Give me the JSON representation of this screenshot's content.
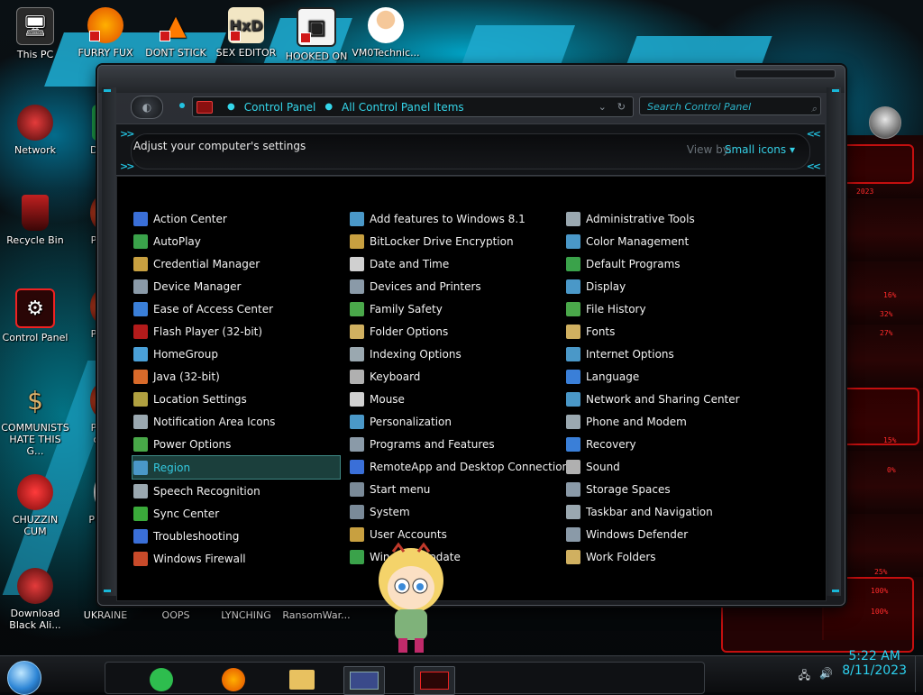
{
  "desktop": {
    "icons": [
      {
        "label": "This PC"
      },
      {
        "label": "FURRY FUX"
      },
      {
        "label": "DONT STICK"
      },
      {
        "label": "SEX EDITOR"
      },
      {
        "label": "HOOKED ON"
      },
      {
        "label": "VM0Technic..."
      },
      {
        "label": "Network"
      },
      {
        "label": "D DUM"
      },
      {
        "label": "Recycle Bin"
      },
      {
        "label": "Peggle"
      },
      {
        "label": "Control Panel"
      },
      {
        "label": "Peggle De"
      },
      {
        "label": "COMMUNISTS HATE THIS G..."
      },
      {
        "label": "Peggle of Wa"
      },
      {
        "label": "CHUZZIN CUM"
      },
      {
        "label": "Plan Zo"
      },
      {
        "label": "Download Black Ali..."
      },
      {
        "label": "UKRAINE"
      },
      {
        "label": "OOPS"
      },
      {
        "label": "LYNCHING"
      },
      {
        "label": "RansomWar..."
      }
    ],
    "wallpaper_readouts": [
      "2023",
      "16%",
      "32%",
      "27%",
      "15%",
      "0%",
      "25%",
      "100%",
      "100%"
    ]
  },
  "window": {
    "address": {
      "crumbs": [
        "Control Panel",
        "All Control Panel Items"
      ]
    },
    "search": {
      "placeholder": "Search Control Panel"
    },
    "header": {
      "title": "Adjust your computer's settings",
      "view_by_label": "View by:",
      "view_by_value": "Small icons"
    },
    "columns": [
      [
        {
          "label": "Action Center",
          "icon": "flag-icon",
          "color": "#3a6fd8"
        },
        {
          "label": "AutoPlay",
          "icon": "autoplay-icon",
          "color": "#3aa24a"
        },
        {
          "label": "Credential Manager",
          "icon": "credential-icon",
          "color": "#c8a040"
        },
        {
          "label": "Device Manager",
          "icon": "device-manager-icon",
          "color": "#8a9aa8"
        },
        {
          "label": "Ease of Access Center",
          "icon": "ease-of-access-icon",
          "color": "#3a7fd8"
        },
        {
          "label": "Flash Player (32-bit)",
          "icon": "flash-icon",
          "color": "#b31b1b"
        },
        {
          "label": "HomeGroup",
          "icon": "homegroup-icon",
          "color": "#4aa0d8"
        },
        {
          "label": "Java (32-bit)",
          "icon": "java-icon",
          "color": "#d86a2a"
        },
        {
          "label": "Location Settings",
          "icon": "location-icon",
          "color": "#b0a040"
        },
        {
          "label": "Notification Area Icons",
          "icon": "notification-icon",
          "color": "#9aa8b0"
        },
        {
          "label": "Power Options",
          "icon": "power-icon",
          "color": "#48a848"
        },
        {
          "label": "Region",
          "icon": "region-icon",
          "color": "#4a98c8",
          "selected": true
        },
        {
          "label": "Speech Recognition",
          "icon": "microphone-icon",
          "color": "#9aa8b0"
        },
        {
          "label": "Sync Center",
          "icon": "sync-icon",
          "color": "#3aaa3a"
        },
        {
          "label": "Troubleshooting",
          "icon": "troubleshoot-icon",
          "color": "#3a6fd8"
        },
        {
          "label": "Windows Firewall",
          "icon": "firewall-icon",
          "color": "#c84a2a"
        }
      ],
      [
        {
          "label": "Add features to Windows 8.1",
          "icon": "add-features-icon",
          "color": "#4a98c8"
        },
        {
          "label": "BitLocker Drive Encryption",
          "icon": "bitlocker-icon",
          "color": "#c8a040"
        },
        {
          "label": "Date and Time",
          "icon": "clock-icon",
          "color": "#d0d0d0"
        },
        {
          "label": "Devices and Printers",
          "icon": "printer-icon",
          "color": "#8a9aa8"
        },
        {
          "label": "Family Safety",
          "icon": "family-safety-icon",
          "color": "#4aa84a"
        },
        {
          "label": "Folder Options",
          "icon": "folder-options-icon",
          "color": "#d0b060"
        },
        {
          "label": "Indexing Options",
          "icon": "indexing-icon",
          "color": "#9aa8b0"
        },
        {
          "label": "Keyboard",
          "icon": "keyboard-icon",
          "color": "#b0b0b0"
        },
        {
          "label": "Mouse",
          "icon": "mouse-icon",
          "color": "#d0d0d0"
        },
        {
          "label": "Personalization",
          "icon": "personalization-icon",
          "color": "#4a98c8"
        },
        {
          "label": "Programs and Features",
          "icon": "programs-icon",
          "color": "#8a9aa8"
        },
        {
          "label": "RemoteApp and Desktop Connections",
          "icon": "remoteapp-icon",
          "color": "#3a6fd8"
        },
        {
          "label": "Start menu",
          "icon": "start-menu-icon",
          "color": "#7a8a98"
        },
        {
          "label": "System",
          "icon": "system-icon",
          "color": "#7a8a98"
        },
        {
          "label": "User Accounts",
          "icon": "user-accounts-icon",
          "color": "#c8a040"
        },
        {
          "label": "Windows Update",
          "icon": "windows-update-icon",
          "color": "#3aa24a"
        }
      ],
      [
        {
          "label": "Administrative Tools",
          "icon": "admin-tools-icon",
          "color": "#9aa8b0"
        },
        {
          "label": "Color Management",
          "icon": "color-management-icon",
          "color": "#4a98c8"
        },
        {
          "label": "Default Programs",
          "icon": "default-programs-icon",
          "color": "#3aa24a"
        },
        {
          "label": "Display",
          "icon": "display-icon",
          "color": "#4a98c8"
        },
        {
          "label": "File History",
          "icon": "file-history-icon",
          "color": "#4aa84a"
        },
        {
          "label": "Fonts",
          "icon": "fonts-icon",
          "color": "#d0b060"
        },
        {
          "label": "Internet Options",
          "icon": "internet-options-icon",
          "color": "#4a98c8"
        },
        {
          "label": "Language",
          "icon": "language-icon",
          "color": "#3a7fd8"
        },
        {
          "label": "Network and Sharing Center",
          "icon": "network-sharing-icon",
          "color": "#4a98c8"
        },
        {
          "label": "Phone and Modem",
          "icon": "phone-modem-icon",
          "color": "#9aa8b0"
        },
        {
          "label": "Recovery",
          "icon": "recovery-icon",
          "color": "#3a7fd8"
        },
        {
          "label": "Sound",
          "icon": "sound-icon",
          "color": "#b0b0b0"
        },
        {
          "label": "Storage Spaces",
          "icon": "storage-spaces-icon",
          "color": "#8a9aa8"
        },
        {
          "label": "Taskbar and Navigation",
          "icon": "taskbar-nav-icon",
          "color": "#9aa8b0"
        },
        {
          "label": "Windows Defender",
          "icon": "defender-icon",
          "color": "#8a9aa8"
        },
        {
          "label": "Work Folders",
          "icon": "work-folders-icon",
          "color": "#d0b060"
        }
      ]
    ]
  },
  "taskbar": {
    "clock_time": "5:22 AM",
    "clock_date": "8/11/2023"
  },
  "colors": {
    "accent_cyan": "#23c2e0",
    "selection_bg": "#1b3f3c",
    "window_bg": "#000000"
  }
}
